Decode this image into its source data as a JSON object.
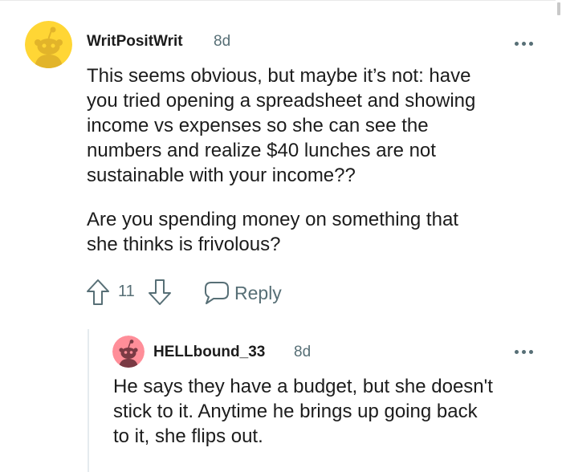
{
  "comment": {
    "username": "WritPositWrit",
    "timestamp": "8d",
    "body_lines": [
      "This seems obvious, but maybe it’s not: have",
      "you tried opening a spreadsheet and showing",
      "income vs expenses so she can see the",
      "numbers and realize $40 lunches are not",
      "sustainable with your income??"
    ],
    "body_lines_2": [
      "Are you spending money on something that",
      "she thinks is frivolous?"
    ],
    "score": "11",
    "reply_label": "Reply",
    "avatar_color": "#ffd635"
  },
  "reply": {
    "username": "HELLbound_33",
    "timestamp": "8d",
    "body_lines": [
      "He says they have a budget, but she doesn't",
      "stick to it. Anytime he brings up going back",
      "to it, she flips out."
    ],
    "avatar_color": "#ff8e99"
  },
  "icons": {
    "upvote": "upvote-arrow-icon",
    "downvote": "downvote-arrow-icon",
    "reply": "speech-bubble-icon",
    "more": "more-options-icon"
  },
  "colors": {
    "meta_text": "#576f76",
    "body_text": "#1c1c1c",
    "thread_line": "#e5ebee"
  }
}
